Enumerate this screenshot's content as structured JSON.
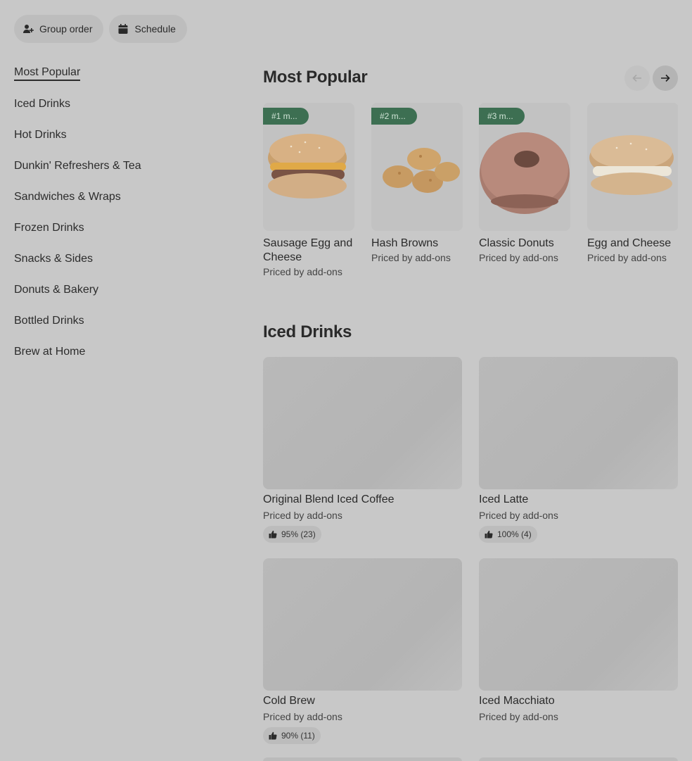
{
  "header": {
    "group_order_label": "Group order",
    "schedule_label": "Schedule"
  },
  "sidebar": {
    "items": [
      {
        "label": "Most Popular"
      },
      {
        "label": "Iced Drinks"
      },
      {
        "label": "Hot Drinks"
      },
      {
        "label": "Dunkin' Refreshers & Tea"
      },
      {
        "label": "Sandwiches & Wraps"
      },
      {
        "label": "Frozen Drinks"
      },
      {
        "label": "Snacks & Sides"
      },
      {
        "label": "Donuts & Bakery"
      },
      {
        "label": "Bottled Drinks"
      },
      {
        "label": "Brew at Home"
      }
    ]
  },
  "most_popular": {
    "title": "Most Popular",
    "items": [
      {
        "badge": "#1 m...",
        "name": "Sausage Egg and Cheese",
        "price": "Priced by add-ons"
      },
      {
        "badge": "#2 m...",
        "name": "Hash Browns",
        "price": "Priced by add-ons"
      },
      {
        "badge": "#3 m...",
        "name": "Classic Donuts",
        "price": "Priced by add-ons"
      },
      {
        "badge": "",
        "name": "Egg and Cheese",
        "price": "Priced by add-ons"
      }
    ]
  },
  "iced_drinks": {
    "title": "Iced Drinks",
    "items": [
      {
        "name": "Original Blend Iced Coffee",
        "price": "Priced by add-ons",
        "rating": "95% (23)"
      },
      {
        "name": "Iced Latte",
        "price": "Priced by add-ons",
        "rating": "100% (4)"
      },
      {
        "name": "Cold Brew",
        "price": "Priced by add-ons",
        "rating": "90% (11)"
      },
      {
        "name": "Iced Macchiato",
        "price": "Priced by add-ons",
        "rating": ""
      }
    ]
  },
  "colors": {
    "overlay_background": "#c8c8c8",
    "badge_green": "#3d6f52"
  }
}
